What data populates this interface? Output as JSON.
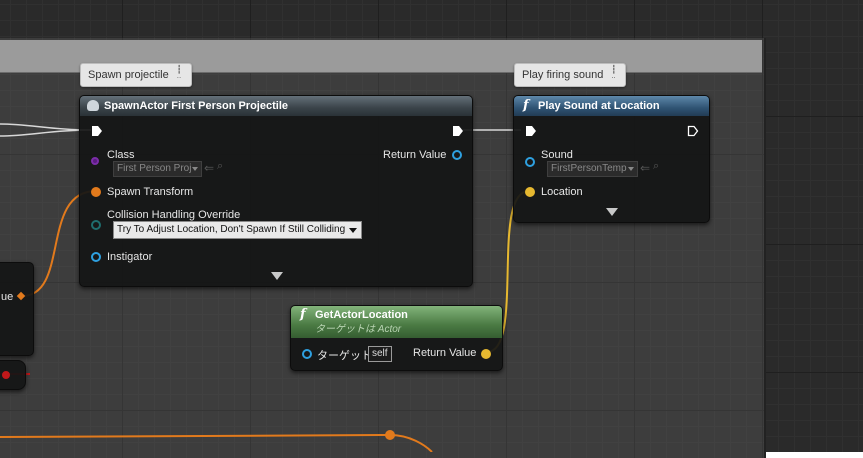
{
  "comments": {
    "spawn": "Spawn projectile",
    "sound": "Play firing sound"
  },
  "spawn_node": {
    "title": "SpawnActor First Person Projectile",
    "class_label": "Class",
    "class_value": "First Person Proj",
    "return_label": "Return Value",
    "spawn_transform_label": "Spawn Transform",
    "collision_label": "Collision Handling Override",
    "collision_value": "Try To Adjust Location, Don't Spawn If Still Colliding",
    "instigator_label": "Instigator"
  },
  "sound_node": {
    "title": "Play Sound at Location",
    "sound_label": "Sound",
    "sound_value": "FirstPersonTemp",
    "location_label": "Location"
  },
  "get_actor_node": {
    "title": "GetActorLocation",
    "subtitle": "ターゲットは Actor",
    "target_label": "ターゲット",
    "target_value": "self",
    "return_label": "Return Value"
  },
  "left_node": {
    "return_fragment": "ue"
  },
  "colors": {
    "exec_wire": "#e0e0e0",
    "transform_wire": "#e27a1c",
    "vector_wire": "#e6b830",
    "class_pin": "#7b2da8",
    "object_pin": "#2ea0e0"
  },
  "icons": {
    "exec": "exec-arrow-icon",
    "func": "function-icon",
    "spawn": "spawn-ghost-icon",
    "pin": "comment-pin-icon",
    "expand": "expand-arrow-icon"
  }
}
